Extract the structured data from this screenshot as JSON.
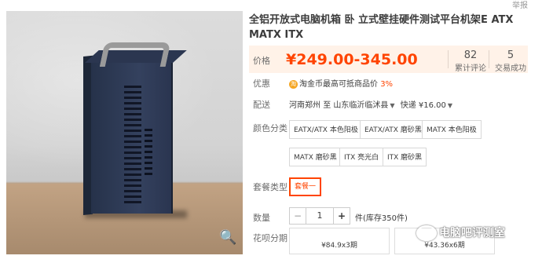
{
  "header": {
    "report_label": "举报"
  },
  "product": {
    "title": "全铝开放式电脑机箱 卧 立式壁挂硬件测试平台机架E ATX MATX ITX"
  },
  "price_section": {
    "label": "价格",
    "price": "¥249.00-345.00",
    "reviews_count": "82",
    "reviews_label": "累计评论",
    "sales_count": "5",
    "sales_label": "交易成功"
  },
  "promo": {
    "label": "优惠",
    "coin_icon": "淘",
    "text": "淘金币最高可抵商品价",
    "percent": "3%"
  },
  "shipping": {
    "label": "配送",
    "from": "河南郑州",
    "to_word": "至",
    "destination": "山东临沂临沭县",
    "method": "快递 ¥16.00"
  },
  "color": {
    "label": "颜色分类",
    "options": [
      "EATX/ATX 本色阳极",
      "EATX/ATX 磨砂黑",
      "MATX 本色阳极",
      "MATX 磨砂黑",
      "ITX 亮光白",
      "ITX 磨砂黑"
    ]
  },
  "package": {
    "label": "套餐类型",
    "selected": "套餐一"
  },
  "quantity": {
    "label": "数量",
    "value": "1",
    "minus": "−",
    "plus": "+",
    "stock": "件(库存350件)"
  },
  "installment": {
    "label": "花呗分期",
    "options": [
      "¥84.9x3期",
      "¥43.36x6期"
    ]
  },
  "watermark": {
    "text": "电脑吧评测室"
  }
}
